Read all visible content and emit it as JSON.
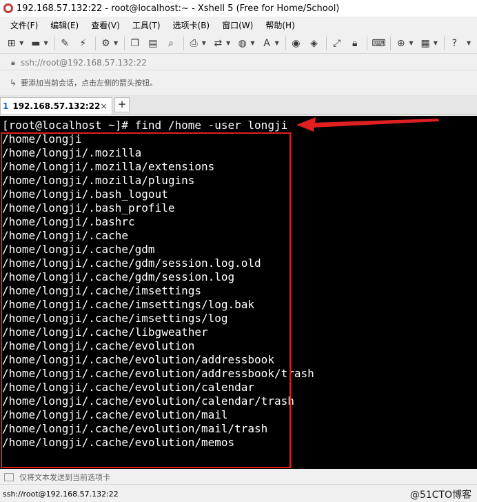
{
  "window": {
    "title": "192.168.57.132:22 - root@localhost:~ - Xshell 5 (Free for Home/School)"
  },
  "menu": [
    "文件(F)",
    "编辑(E)",
    "查看(V)",
    "工具(T)",
    "选项卡(B)",
    "窗口(W)",
    "帮助(H)"
  ],
  "address": {
    "value": "ssh://root@192.168.57.132:22"
  },
  "hint": {
    "text": "要添加当前会话，点击左侧的箭头按钮。"
  },
  "tabs": {
    "active_num": "1",
    "active_label": "192.168.57.132:22",
    "close": "×",
    "add": "+"
  },
  "terminal": {
    "command": "[root@localhost ~]# find /home -user longji",
    "lines": [
      "/home/longji",
      "/home/longji/.mozilla",
      "/home/longji/.mozilla/extensions",
      "/home/longji/.mozilla/plugins",
      "/home/longji/.bash_logout",
      "/home/longji/.bash_profile",
      "/home/longji/.bashrc",
      "/home/longji/.cache",
      "/home/longji/.cache/gdm",
      "/home/longji/.cache/gdm/session.log.old",
      "/home/longji/.cache/gdm/session.log",
      "/home/longji/.cache/imsettings",
      "/home/longji/.cache/imsettings/log.bak",
      "/home/longji/.cache/imsettings/log",
      "/home/longji/.cache/libgweather",
      "/home/longji/.cache/evolution",
      "/home/longji/.cache/evolution/addressbook",
      "/home/longji/.cache/evolution/addressbook/trash",
      "/home/longji/.cache/evolution/calendar",
      "/home/longji/.cache/evolution/calendar/trash",
      "/home/longji/.cache/evolution/mail",
      "/home/longji/.cache/evolution/mail/trash",
      "/home/longji/.cache/evolution/memos"
    ]
  },
  "compose": {
    "text": "仅将文本发送到当前选项卡"
  },
  "status": {
    "connection": "ssh://root@192.168.57.132:22",
    "watermark": "@51CTO博客"
  },
  "colors": {
    "annotation": "#e02020",
    "terminal_bg": "#000000",
    "terminal_fg": "#ffffff"
  }
}
